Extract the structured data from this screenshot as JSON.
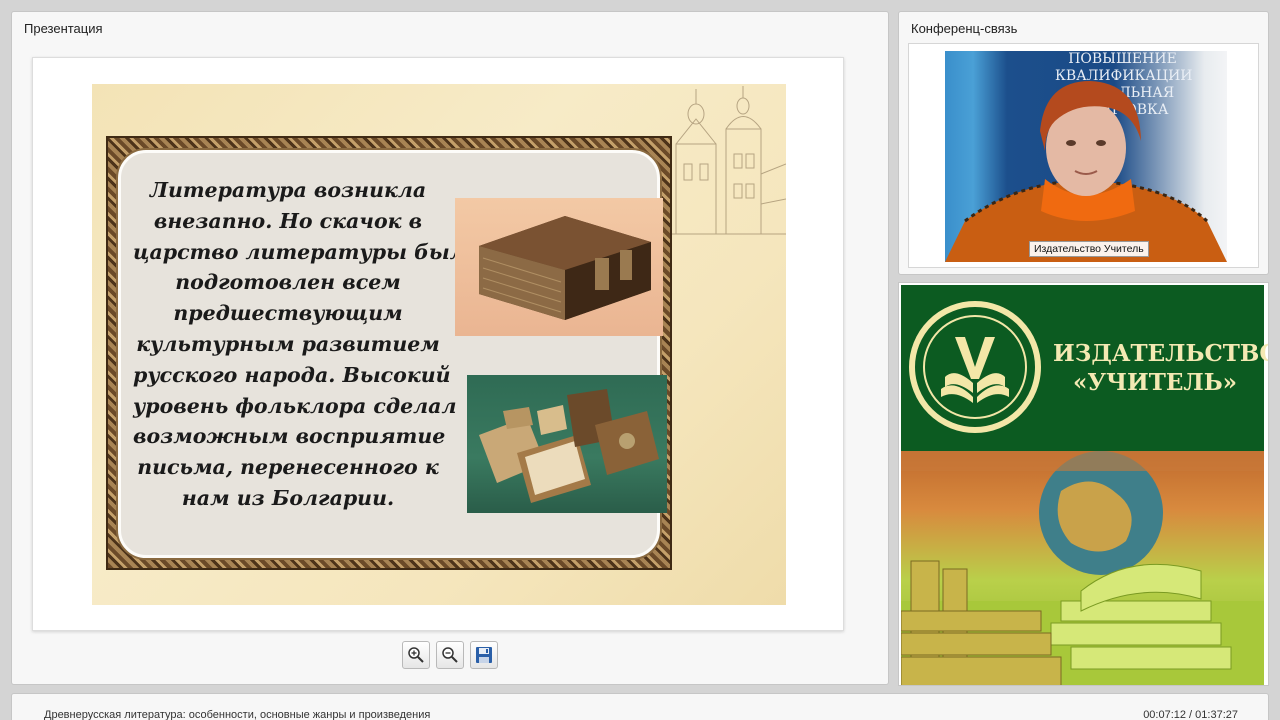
{
  "presentation": {
    "title": "Презентация",
    "slide_lines": [
      "Литература возникла",
      "внезапно. Но скачок в",
      "царство литературы был",
      "подготовлен всем",
      "предшествующим",
      "культурным развитием",
      "русского народа. Высокий",
      "уровень фольклора сделал",
      "возможным восприятие",
      "письма, перенесенного к",
      "нам из Болгарии."
    ],
    "tools": [
      "zoom-in-icon",
      "zoom-out-icon",
      "save-icon"
    ]
  },
  "conference": {
    "title": "Конференц-связь",
    "banner_lines": [
      "ПОВЫШЕНИЕ",
      "КВАЛИФИКАЦИИ",
      "ПРО    АЛЬНАЯ",
      "ПОДГ    ОВКА"
    ],
    "name_tag": "Издательство Учитель"
  },
  "brand": {
    "line1": "ИЗДАТЕЛЬСТВО",
    "line2": "«УЧИТЕЛЬ»",
    "colors": {
      "green": "#0c5b21",
      "gold": "#f4e9b3"
    }
  },
  "footer": {
    "lecture_title": "Древнерусская литература: особенности, основные жанры и произведения",
    "time": "00:07:12 / 01:37:27"
  }
}
